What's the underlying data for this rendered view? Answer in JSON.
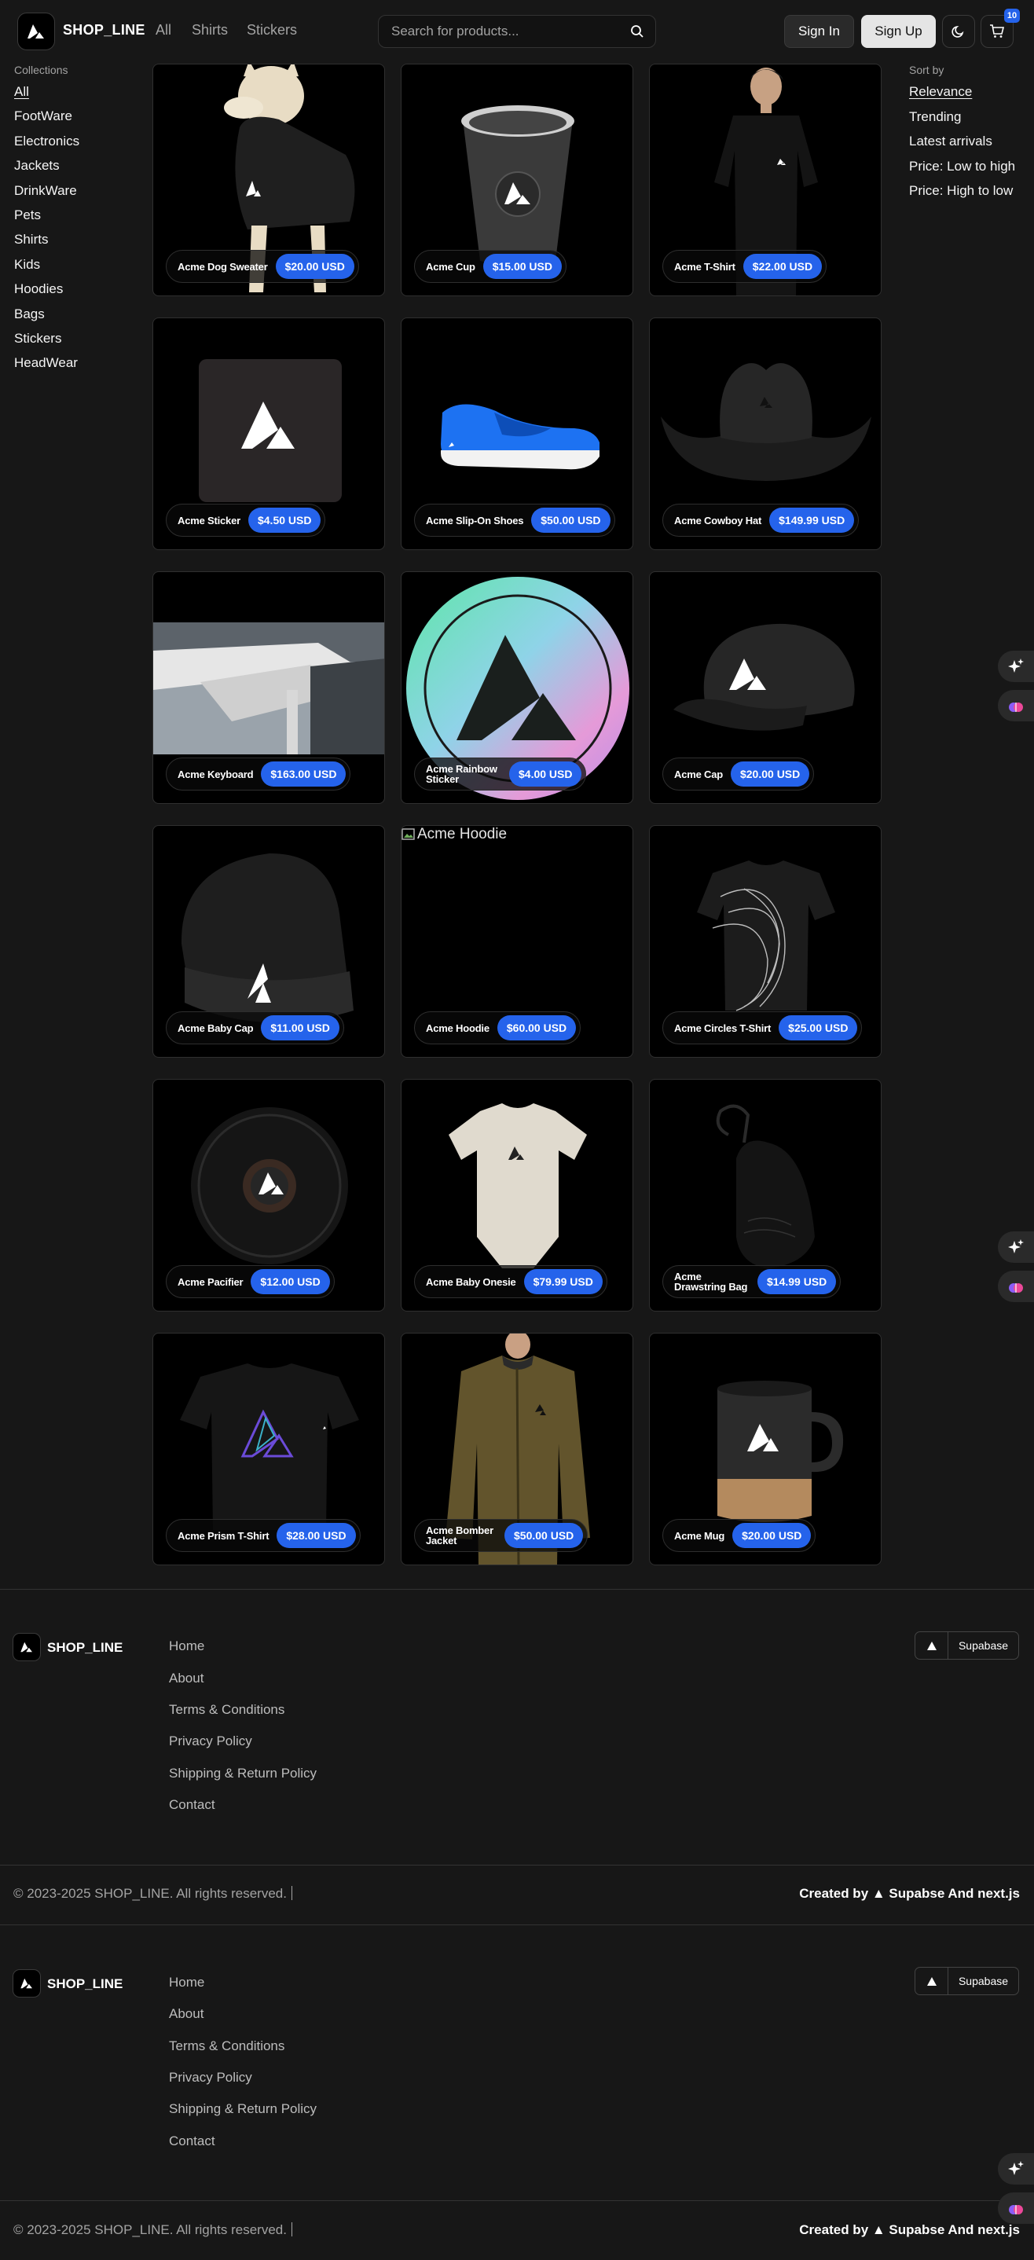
{
  "header": {
    "brand": "SHOP_LINE",
    "nav": [
      "All",
      "Shirts",
      "Stickers"
    ],
    "search_placeholder": "Search for products...",
    "sign_in": "Sign In",
    "sign_up": "Sign Up",
    "cart_count": "10"
  },
  "collections": {
    "heading": "Collections",
    "items": [
      "All",
      "FootWare",
      "Electronics",
      "Jackets",
      "DrinkWare",
      "Pets",
      "Shirts",
      "Kids",
      "Hoodies",
      "Bags",
      "Stickers",
      "HeadWear"
    ],
    "active": "All"
  },
  "sort": {
    "heading": "Sort by",
    "items": [
      "Relevance",
      "Trending",
      "Latest arrivals",
      "Price: Low to high",
      "Price: High to low"
    ],
    "active": "Relevance"
  },
  "products": [
    {
      "name": "Acme Dog Sweater",
      "price": "$20.00 USD",
      "icon": "dog-sweater"
    },
    {
      "name": "Acme Cup",
      "price": "$15.00 USD",
      "icon": "cup"
    },
    {
      "name": "Acme T-Shirt",
      "price": "$22.00 USD",
      "icon": "t-shirt-model"
    },
    {
      "name": "Acme Sticker",
      "price": "$4.50 USD",
      "icon": "sticker"
    },
    {
      "name": "Acme Slip-On Shoes",
      "price": "$50.00 USD",
      "icon": "shoe"
    },
    {
      "name": "Acme Cowboy Hat",
      "price": "$149.99 USD",
      "icon": "cowboy-hat"
    },
    {
      "name": "Acme Keyboard",
      "price": "$163.00 USD",
      "icon": "keyboard"
    },
    {
      "name": "Acme Rainbow Sticker",
      "price": "$4.00 USD",
      "icon": "rainbow-sticker"
    },
    {
      "name": "Acme Cap",
      "price": "$20.00 USD",
      "icon": "cap"
    },
    {
      "name": "Acme Baby Cap",
      "price": "$11.00 USD",
      "icon": "beanie"
    },
    {
      "name": "Acme Hoodie",
      "price": "$60.00 USD",
      "icon": "broken-image",
      "alt": "Acme Hoodie"
    },
    {
      "name": "Acme Circles T-Shirt",
      "price": "$25.00 USD",
      "icon": "circles-t-shirt"
    },
    {
      "name": "Acme Pacifier",
      "price": "$12.00 USD",
      "icon": "pacifier"
    },
    {
      "name": "Acme Baby Onesie",
      "price": "$79.99 USD",
      "icon": "onesie"
    },
    {
      "name": "Acme Drawstring Bag",
      "price": "$14.99 USD",
      "icon": "drawstring-bag"
    },
    {
      "name": "Acme Prism T-Shirt",
      "price": "$28.00 USD",
      "icon": "prism-t-shirt"
    },
    {
      "name": "Acme Bomber Jacket",
      "price": "$50.00 USD",
      "icon": "bomber-jacket"
    },
    {
      "name": "Acme Mug",
      "price": "$20.00 USD",
      "icon": "mug"
    }
  ],
  "footer": {
    "brand": "SHOP_LINE",
    "links": [
      "Home",
      "About",
      "Terms & Conditions",
      "Privacy Policy",
      "Shipping & Return Policy",
      "Contact"
    ],
    "deploy_label": "Supabase",
    "copyright": "© 2023-2025 SHOP_LINE. All rights reserved.",
    "created_by": "Created by ▲ Supabse And next.js"
  },
  "colors": {
    "accent": "#2563eb",
    "background": "#171717",
    "card": "#000000"
  }
}
